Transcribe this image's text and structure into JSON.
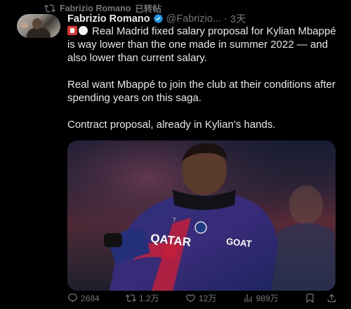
{
  "repost": {
    "author": "Fabrizio Romano",
    "suffix": "已转帖"
  },
  "tweet": {
    "name": "Fabrizio Romano",
    "handle": "@Fabrizio...",
    "separator": "·",
    "time": "3天",
    "paragraphs": [
      "Real Madrid fixed salary proposal for Kylian Mbappé is way lower than the one made in summer 2022 — and also lower than current salary.",
      "Real want Mbappé to join the club at their conditions after spending years on this saga.",
      "Contract proposal, already in Kylian’s hands."
    ],
    "emojis": [
      "flag-red-white-emoji",
      "white-circle-emoji"
    ]
  },
  "media": {
    "jersey_sponsor": "QATAR",
    "jersey_sleeve": "GOAT",
    "jersey_number": "7",
    "colors": {
      "jersey": "#27306e",
      "accent": "#d2233c"
    }
  },
  "actions": {
    "replies": "2684",
    "retweets": "1.2万",
    "likes": "12万",
    "views": "989万"
  },
  "colors": {
    "background": "#000000",
    "text": "#e7e9ea",
    "muted": "#71767b",
    "verified": "#1d9bf0"
  }
}
